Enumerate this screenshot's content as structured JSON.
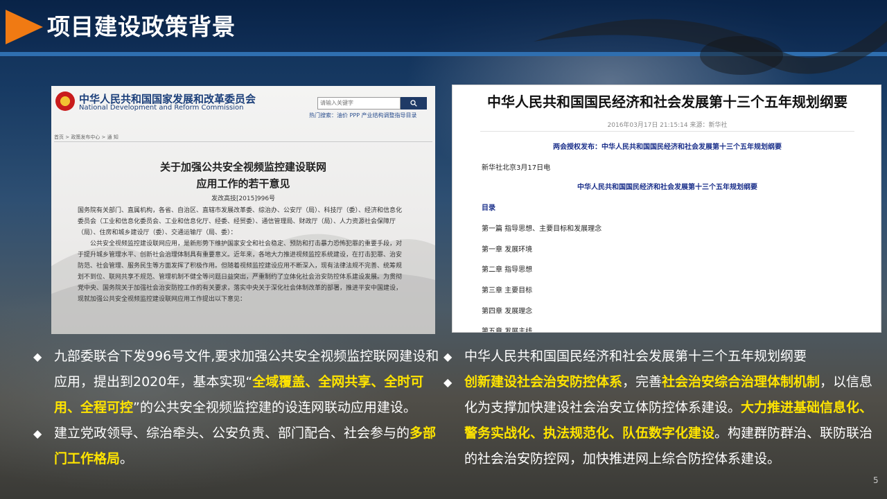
{
  "header": {
    "title": "项目建设政策背景"
  },
  "colors": {
    "accent": "#f07a13",
    "header_bg": "#0c2a52",
    "highlight": "#ffe400",
    "doc_link": "#1a2f8a"
  },
  "left_document": {
    "org_cn": "中华人民共和国国家发展和改革委员会",
    "org_en": "National Development and Reform Commission",
    "search_placeholder": "请输入关键字",
    "search_button_icon": "magnifier-icon",
    "hot_search": "热门搜索：油价  PPP  产业结构调整指导目录",
    "breadcrumb": "首页 > 政策发布中心 > 通      知",
    "title_line1": "关于加强公共安全视频监控建设联网",
    "title_line2": "应用工作的若干意见",
    "doc_number": "发改高技[2015]996号",
    "body": [
      "国务院有关部门、直属机构，各省、自治区、直辖市发展改革委、综治办、公安厅（局）、科技厅（委）、经济和信息化委员会（工业和信息化委员会、工业和信息化厅、经委、经贸委）、通信管理局、财政厅（局）、人力资源社会保障厅（局）、住房和城乡建设厅（委）、交通运输厅（局、委）：",
      "公共安全视频监控建设联网应用，是新形势下维护国家安全和社会稳定、预防和打击暴力恐怖犯罪的重要手段，对于提升城乡管理水平、创新社会治理体制具有重要意义。近年来，各地大力推进视频监控系统建设，在打击犯罪、治安防范、社会管理、服务民生等方面发挥了积极作用。但随着视频监控建设应用不断深入，现有法律法规不完善、统筹规划不到位、联网共享不规范、管理机制不健全等问题日益突出，严重制约了立体化社会治安防控体系建设发展。为贯彻党中央、国务院关于加强社会治安防控工作的有关要求，落实中央关于深化社会体制改革的部署，推进平安中国建设，现就加强公共安全视频监控建设联网应用工作提出以下意见："
    ]
  },
  "right_document": {
    "title": "中华人民共和国国民经济和社会发展第十三个五年规划纲要",
    "meta": "2016年03月17日 21:15:14  来源：新华社",
    "subtitle": "两会授权发布：中华人民共和国国民经济和社会发展第十三个五年规划纲要",
    "dateline": "新华社北京3月17日电",
    "subtitle2": "中华人民共和国国民经济和社会发展第十三个五年规划纲要",
    "toc_label": "目录",
    "toc": [
      "第一篇    指导思想、主要目标和发展理念",
      "第一章    发展环境",
      "第二章    指导思想",
      "第三章    主要目标",
      "第四章    发展理念",
      "第五章    发展主线"
    ]
  },
  "bullets_left": [
    {
      "marker": "◆",
      "parts": [
        {
          "text": "九部委联合下发996号文件,要求加强公共安全视频监控联网建设和应用，提出到2020年，基本实现“",
          "highlight": false
        },
        {
          "text": "全域覆盖、全网共享、全时可用、全程可控",
          "highlight": true
        },
        {
          "text": "”的公共安全视频监控建的设连网联动应用建设。",
          "highlight": false
        }
      ]
    },
    {
      "marker": "◆",
      "parts": [
        {
          "text": "建立党政领导、综治牵头、公安负责、部门配合、社会参与的",
          "highlight": false
        },
        {
          "text": "多部门工作格局",
          "highlight": true
        },
        {
          "text": "。",
          "highlight": false
        }
      ]
    }
  ],
  "bullets_right": [
    {
      "marker": "◆",
      "parts": [
        {
          "text": "中华人民共和国国民经济和社会发展第十三个五年规划纲要",
          "highlight": false
        }
      ]
    },
    {
      "marker": "◆",
      "parts": [
        {
          "text": "创新建设社会治安防控体系",
          "highlight": true
        },
        {
          "text": "，完善",
          "highlight": false
        },
        {
          "text": "社会治安综合治理体制机制",
          "highlight": true
        },
        {
          "text": "，以信息化为支撑加快建设社会治安立体防控体系建设。",
          "highlight": false
        },
        {
          "text": "大力推进基础信息化、警务实战化、执法规范化、队伍数字化建设",
          "highlight": true
        },
        {
          "text": "。构建群防群治、联防联治的社会治安防控网，加快推进网上综合防控体系建设。",
          "highlight": false
        }
      ]
    }
  ],
  "page_number": "5"
}
